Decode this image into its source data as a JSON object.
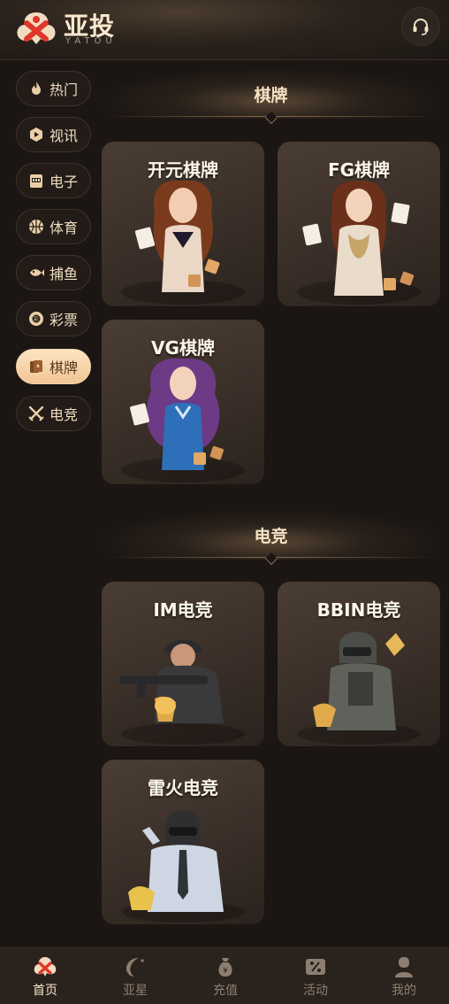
{
  "header": {
    "brand_cn": "亚投",
    "brand_en": "YATOU",
    "support_icon": "headset-icon"
  },
  "sidebar": {
    "items": [
      {
        "label": "热门",
        "icon": "flame-icon",
        "active": false
      },
      {
        "label": "视讯",
        "icon": "video-hexagon-icon",
        "active": false
      },
      {
        "label": "电子",
        "icon": "slot-machine-icon",
        "active": false
      },
      {
        "label": "体育",
        "icon": "basketball-icon",
        "active": false
      },
      {
        "label": "捕鱼",
        "icon": "fish-icon",
        "active": false
      },
      {
        "label": "彩票",
        "icon": "lottery-ball-icon",
        "active": false
      },
      {
        "label": "棋牌",
        "icon": "cards-icon",
        "active": true
      },
      {
        "label": "电竞",
        "icon": "crossed-swords-icon",
        "active": false
      }
    ]
  },
  "sections": [
    {
      "title": "棋牌",
      "cards": [
        {
          "title": "开元棋牌",
          "art": "woman-with-mahjong-tiles"
        },
        {
          "title": "FG棋牌",
          "art": "woman-with-mahjong-tiles"
        },
        {
          "title": "VG棋牌",
          "art": "woman-with-mahjong-tiles"
        }
      ]
    },
    {
      "title": "电竞",
      "cards": [
        {
          "title": "IM电竞",
          "art": "soldier-with-rifle"
        },
        {
          "title": "BBIN电竞",
          "art": "armored-soldier"
        },
        {
          "title": "雷火电竞",
          "art": "helmeted-soldier"
        }
      ]
    }
  ],
  "bottom_nav": [
    {
      "label": "首页",
      "icon": "home-logo-icon",
      "active": true
    },
    {
      "label": "亚星",
      "icon": "crescent-star-icon",
      "active": false
    },
    {
      "label": "充值",
      "icon": "money-bag-icon",
      "active": false
    },
    {
      "label": "活动",
      "icon": "coupon-icon",
      "active": false
    },
    {
      "label": "我的",
      "icon": "user-icon",
      "active": false
    }
  ],
  "colors": {
    "background": "#1b1613",
    "accent": "#f1c596",
    "text": "#f3e4cc",
    "logo_red": "#e0362c"
  }
}
